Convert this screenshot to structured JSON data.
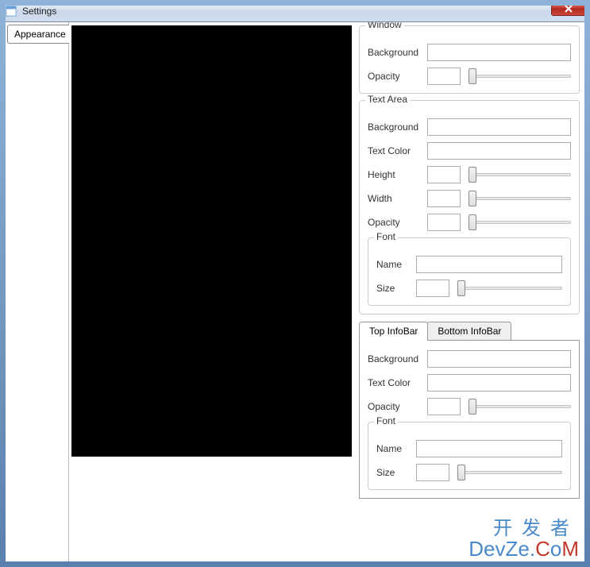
{
  "window": {
    "title": "Settings"
  },
  "sidebar": {
    "tab_appearance": "Appearance"
  },
  "groups": {
    "window": {
      "title": "Window",
      "background_label": "Background",
      "opacity_label": "Opacity",
      "background_value": "",
      "opacity_value": ""
    },
    "textarea": {
      "title": "Text Area",
      "background_label": "Background",
      "textcolor_label": "Text Color",
      "height_label": "Height",
      "width_label": "Width",
      "opacity_label": "Opacity",
      "background_value": "",
      "textcolor_value": "",
      "height_value": "",
      "width_value": "",
      "opacity_value": "",
      "font": {
        "title": "Font",
        "name_label": "Name",
        "size_label": "Size",
        "name_value": "",
        "size_value": ""
      }
    },
    "infobar": {
      "tab_top": "Top InfoBar",
      "tab_bottom": "Bottom InfoBar",
      "background_label": "Background",
      "textcolor_label": "Text Color",
      "opacity_label": "Opacity",
      "background_value": "",
      "textcolor_value": "",
      "opacity_value": "",
      "font": {
        "title": "Font",
        "name_label": "Name",
        "size_label": "Size",
        "name_value": "",
        "size_value": ""
      }
    }
  },
  "watermark": {
    "line1": "开发者",
    "line2_plain": "DevZe.",
    "line2_c": "C",
    "line2_o": "o",
    "line2_m": "M"
  }
}
